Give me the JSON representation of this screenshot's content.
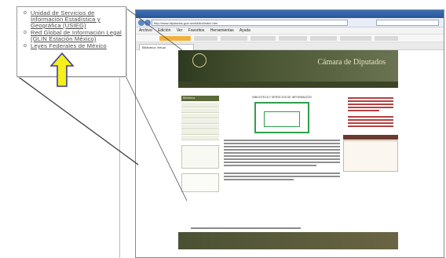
{
  "callout": {
    "links": [
      {
        "text": "Unidad de Servicios de Información Estadística y Geográfica (USIEG)"
      },
      {
        "text": "Red Global de Información Legal (GLIN Estación México)"
      },
      {
        "text": "Leyes Federales de México"
      }
    ]
  },
  "browser": {
    "url": "http://www.diputados.gob.mx/bibliot/index.htm",
    "menu": [
      "Archivo",
      "Edición",
      "Ver",
      "Favoritos",
      "Herramientas",
      "Ayuda"
    ],
    "tab_title": "Biblioteca Virtual"
  },
  "page": {
    "brand": "Cámara de Diputados",
    "section_title": "BIBLIOTECA Y SERVICIOS DE INFORMACIÓN",
    "side_heading": "Biblioteca"
  },
  "colors": {
    "arrow_fill": "#f5ef1c",
    "banner": "#4b5634",
    "link_green": "#2f9e4f"
  }
}
